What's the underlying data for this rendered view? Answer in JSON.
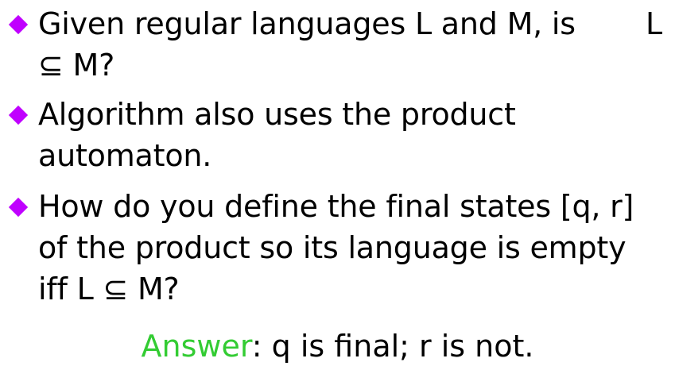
{
  "bullets": [
    {
      "lines": [
        "Given regular languages L and M, is",
        "⊆ M?"
      ],
      "trailing_L": "L"
    },
    {
      "lines": [
        "Algorithm also uses the product",
        "automaton."
      ]
    },
    {
      "lines": [
        "How do you define the final states [q, r]",
        "of the product so its language is empty",
        "iff L ⊆ M?"
      ]
    }
  ],
  "answer": {
    "label": "Answer",
    "text": ": q is final; r is not."
  },
  "colors": {
    "bullet": "#c000ff",
    "answer_label": "#33cc33",
    "text": "#000000"
  },
  "icons": {
    "bullet": "diamond-icon"
  }
}
